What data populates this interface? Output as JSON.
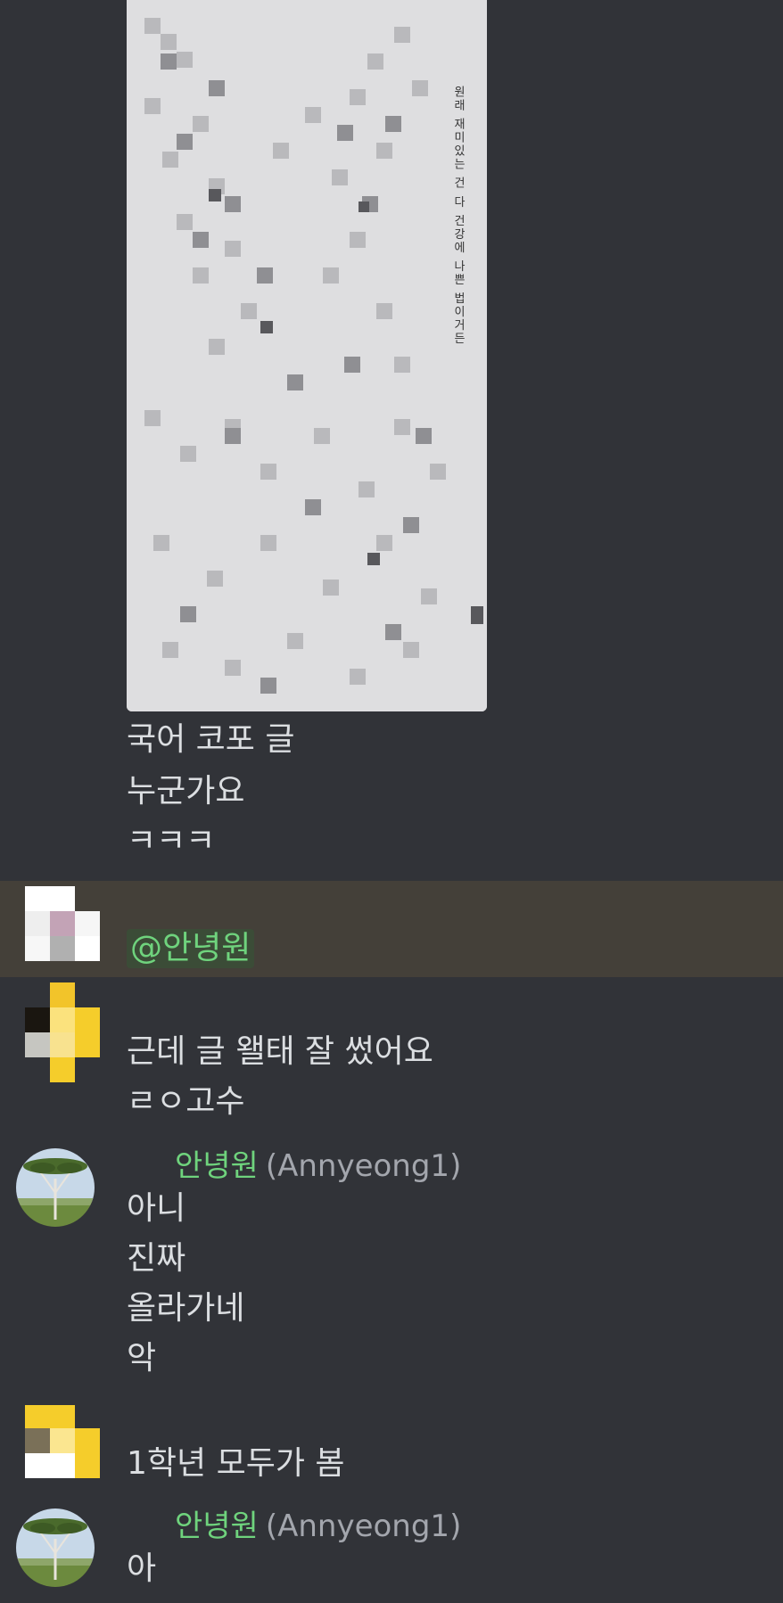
{
  "colors": {
    "background": "#313338",
    "highlight": "#444039",
    "username_green": "#6fd37d",
    "mention_bg": "#3b4c37",
    "text": "#dbdee1",
    "muted": "#a3a6ad"
  },
  "attachment": {
    "visible_text": "원래 재미있는 건 다 건강에 나쁜 법이거든"
  },
  "message1": {
    "lines": [
      "국어 코포 글",
      "누군가요",
      "ㅋㅋㅋ"
    ]
  },
  "message2": {
    "mention": "@안녕원"
  },
  "message3": {
    "lines": [
      "근데 글 왤태 잘 썼어요",
      "ㄹㅇ고수"
    ]
  },
  "message4": {
    "author_name": "안녕원",
    "author_handle": "(Annyeong1)",
    "lines": [
      "아니",
      "진짜",
      "올라가네",
      "악"
    ]
  },
  "message5": {
    "lines": [
      "1학년 모두가 봄"
    ]
  },
  "message6": {
    "author_name": "안녕원",
    "author_handle": "(Annyeong1)",
    "lines": [
      "아"
    ]
  }
}
